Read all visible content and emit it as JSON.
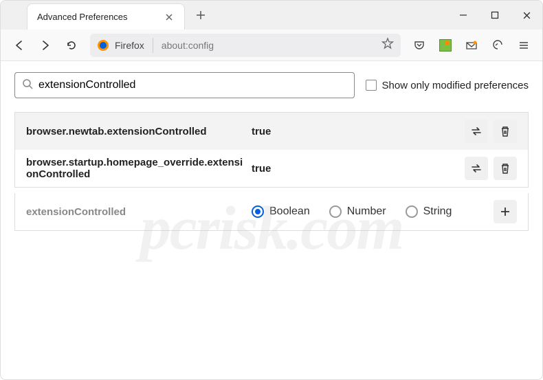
{
  "titlebar": {
    "tab_title": "Advanced Preferences"
  },
  "urlbar": {
    "label": "Firefox",
    "url": "about:config"
  },
  "search": {
    "value": "extensionControlled",
    "checkbox_label": "Show only modified preferences"
  },
  "prefs": [
    {
      "name": "browser.newtab.extensionControlled",
      "value": "true"
    },
    {
      "name": "browser.startup.homepage_override.extensionControlled",
      "value": "true"
    }
  ],
  "new_pref": {
    "name": "extensionControlled",
    "types": [
      "Boolean",
      "Number",
      "String"
    ],
    "selected_index": 0
  },
  "watermark": "pcrisk.com"
}
